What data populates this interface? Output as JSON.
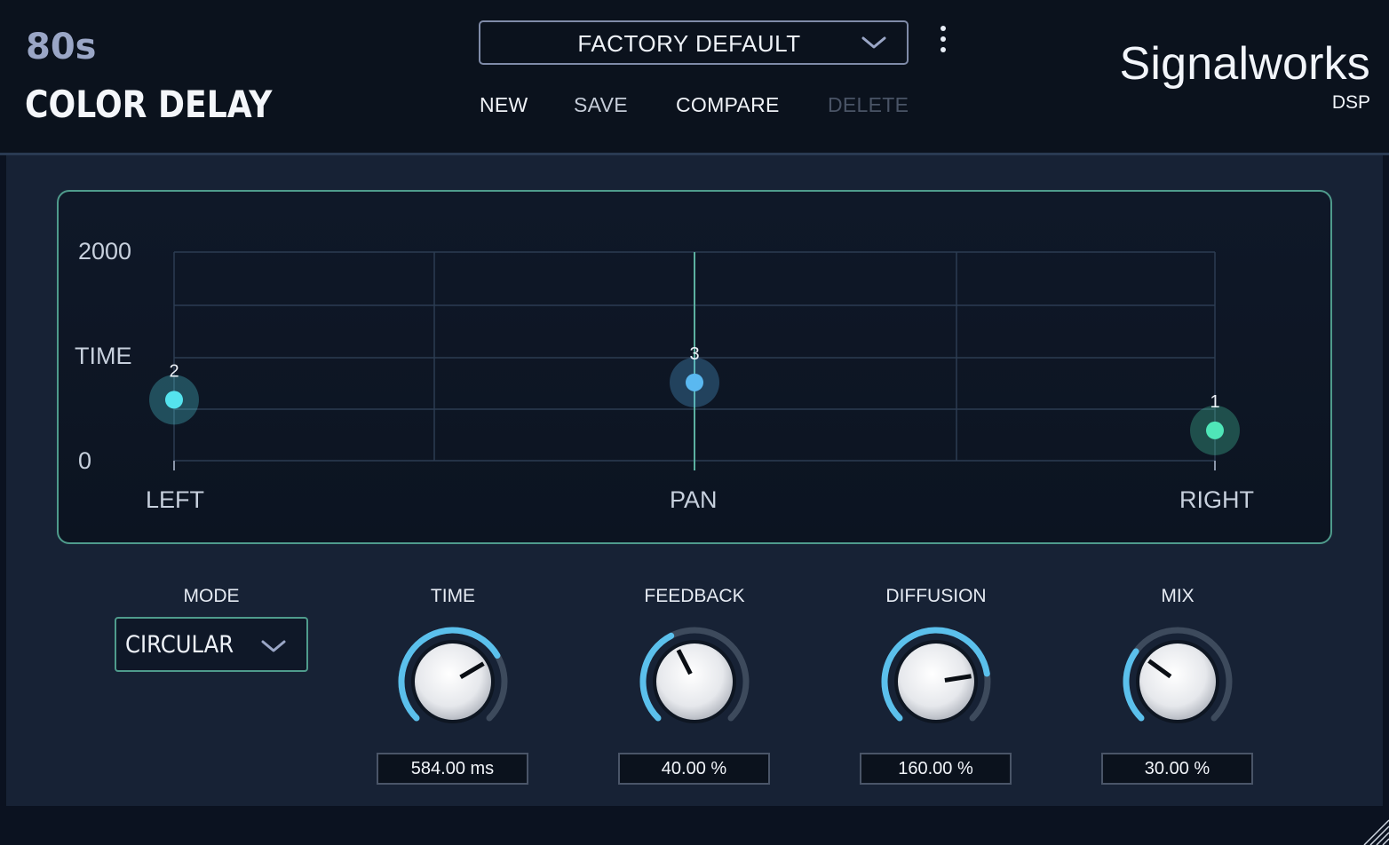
{
  "header": {
    "brand_top": "80s",
    "brand_title": "COLOR DELAY",
    "preset": {
      "name": "FACTORY DEFAULT",
      "dropdown_icon": "chevron-down-icon"
    },
    "menu_icon": "more-vertical-icon",
    "buttons": [
      {
        "label": "NEW",
        "enabled": true
      },
      {
        "label": "SAVE",
        "enabled": true
      },
      {
        "label": "COMPARE",
        "enabled": true
      },
      {
        "label": "DELETE",
        "enabled": false
      }
    ],
    "company": "Signalworks",
    "company_sub": "DSP"
  },
  "graph": {
    "y_max_label": "2000",
    "y_min_label": "0",
    "y_axis_title": "TIME",
    "x_left_label": "LEFT",
    "x_center_label": "PAN",
    "x_right_label": "RIGHT",
    "taps": [
      {
        "id": "2",
        "pan": -1.0,
        "time": 584,
        "color": "#55e3ee"
      },
      {
        "id": "3",
        "pan": 0.0,
        "time": 750,
        "color": "#5ab8f0"
      },
      {
        "id": "1",
        "pan": 1.0,
        "time": 290,
        "color": "#4fe6b8"
      }
    ]
  },
  "controls": {
    "mode": {
      "label": "MODE",
      "value": "CIRCULAR"
    },
    "knobs": [
      {
        "label": "TIME",
        "value": "584.00 ms",
        "level": 0.72
      },
      {
        "label": "FEEDBACK",
        "value": "40.00 %",
        "level": 0.4
      },
      {
        "label": "DIFFUSION",
        "value": "160.00 %",
        "level": 0.8
      },
      {
        "label": "MIX",
        "value": "30.00 %",
        "level": 0.3
      }
    ]
  },
  "colors": {
    "accent": "#5bc0ec",
    "border_teal": "#4f9b8c",
    "panel": "#172235",
    "background": "#0b121d"
  }
}
